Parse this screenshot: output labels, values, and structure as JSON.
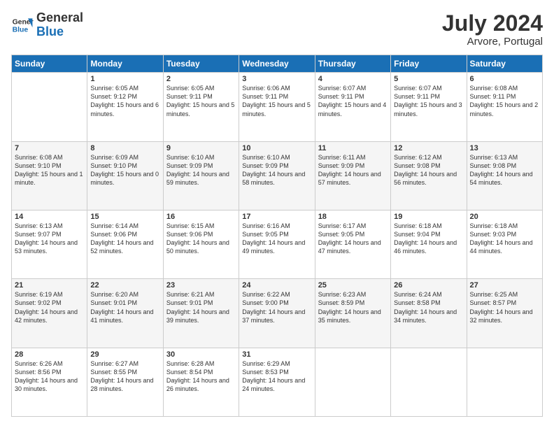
{
  "logo": {
    "line1": "General",
    "line2": "Blue"
  },
  "title": "July 2024",
  "location": "Arvore, Portugal",
  "weekdays": [
    "Sunday",
    "Monday",
    "Tuesday",
    "Wednesday",
    "Thursday",
    "Friday",
    "Saturday"
  ],
  "weeks": [
    [
      null,
      {
        "day": 1,
        "sunrise": "6:05 AM",
        "sunset": "9:12 PM",
        "daylight": "15 hours and 6 minutes."
      },
      {
        "day": 2,
        "sunrise": "6:05 AM",
        "sunset": "9:11 PM",
        "daylight": "15 hours and 5 minutes."
      },
      {
        "day": 3,
        "sunrise": "6:06 AM",
        "sunset": "9:11 PM",
        "daylight": "15 hours and 5 minutes."
      },
      {
        "day": 4,
        "sunrise": "6:07 AM",
        "sunset": "9:11 PM",
        "daylight": "15 hours and 4 minutes."
      },
      {
        "day": 5,
        "sunrise": "6:07 AM",
        "sunset": "9:11 PM",
        "daylight": "15 hours and 3 minutes."
      },
      {
        "day": 6,
        "sunrise": "6:08 AM",
        "sunset": "9:11 PM",
        "daylight": "15 hours and 2 minutes."
      }
    ],
    [
      {
        "day": 7,
        "sunrise": "6:08 AM",
        "sunset": "9:10 PM",
        "daylight": "15 hours and 1 minute."
      },
      {
        "day": 8,
        "sunrise": "6:09 AM",
        "sunset": "9:10 PM",
        "daylight": "15 hours and 0 minutes."
      },
      {
        "day": 9,
        "sunrise": "6:10 AM",
        "sunset": "9:09 PM",
        "daylight": "14 hours and 59 minutes."
      },
      {
        "day": 10,
        "sunrise": "6:10 AM",
        "sunset": "9:09 PM",
        "daylight": "14 hours and 58 minutes."
      },
      {
        "day": 11,
        "sunrise": "6:11 AM",
        "sunset": "9:09 PM",
        "daylight": "14 hours and 57 minutes."
      },
      {
        "day": 12,
        "sunrise": "6:12 AM",
        "sunset": "9:08 PM",
        "daylight": "14 hours and 56 minutes."
      },
      {
        "day": 13,
        "sunrise": "6:13 AM",
        "sunset": "9:08 PM",
        "daylight": "14 hours and 54 minutes."
      }
    ],
    [
      {
        "day": 14,
        "sunrise": "6:13 AM",
        "sunset": "9:07 PM",
        "daylight": "14 hours and 53 minutes."
      },
      {
        "day": 15,
        "sunrise": "6:14 AM",
        "sunset": "9:06 PM",
        "daylight": "14 hours and 52 minutes."
      },
      {
        "day": 16,
        "sunrise": "6:15 AM",
        "sunset": "9:06 PM",
        "daylight": "14 hours and 50 minutes."
      },
      {
        "day": 17,
        "sunrise": "6:16 AM",
        "sunset": "9:05 PM",
        "daylight": "14 hours and 49 minutes."
      },
      {
        "day": 18,
        "sunrise": "6:17 AM",
        "sunset": "9:05 PM",
        "daylight": "14 hours and 47 minutes."
      },
      {
        "day": 19,
        "sunrise": "6:18 AM",
        "sunset": "9:04 PM",
        "daylight": "14 hours and 46 minutes."
      },
      {
        "day": 20,
        "sunrise": "6:18 AM",
        "sunset": "9:03 PM",
        "daylight": "14 hours and 44 minutes."
      }
    ],
    [
      {
        "day": 21,
        "sunrise": "6:19 AM",
        "sunset": "9:02 PM",
        "daylight": "14 hours and 42 minutes."
      },
      {
        "day": 22,
        "sunrise": "6:20 AM",
        "sunset": "9:01 PM",
        "daylight": "14 hours and 41 minutes."
      },
      {
        "day": 23,
        "sunrise": "6:21 AM",
        "sunset": "9:01 PM",
        "daylight": "14 hours and 39 minutes."
      },
      {
        "day": 24,
        "sunrise": "6:22 AM",
        "sunset": "9:00 PM",
        "daylight": "14 hours and 37 minutes."
      },
      {
        "day": 25,
        "sunrise": "6:23 AM",
        "sunset": "8:59 PM",
        "daylight": "14 hours and 35 minutes."
      },
      {
        "day": 26,
        "sunrise": "6:24 AM",
        "sunset": "8:58 PM",
        "daylight": "14 hours and 34 minutes."
      },
      {
        "day": 27,
        "sunrise": "6:25 AM",
        "sunset": "8:57 PM",
        "daylight": "14 hours and 32 minutes."
      }
    ],
    [
      {
        "day": 28,
        "sunrise": "6:26 AM",
        "sunset": "8:56 PM",
        "daylight": "14 hours and 30 minutes."
      },
      {
        "day": 29,
        "sunrise": "6:27 AM",
        "sunset": "8:55 PM",
        "daylight": "14 hours and 28 minutes."
      },
      {
        "day": 30,
        "sunrise": "6:28 AM",
        "sunset": "8:54 PM",
        "daylight": "14 hours and 26 minutes."
      },
      {
        "day": 31,
        "sunrise": "6:29 AM",
        "sunset": "8:53 PM",
        "daylight": "14 hours and 24 minutes."
      },
      null,
      null,
      null
    ]
  ]
}
